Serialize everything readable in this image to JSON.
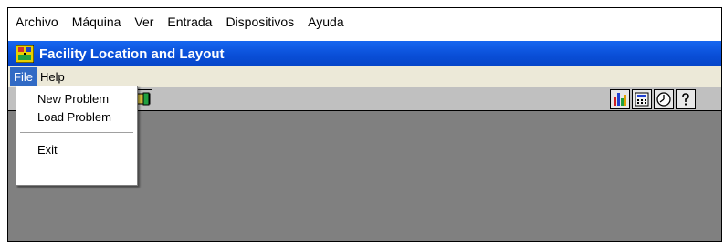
{
  "host_menu": [
    "Archivo",
    "Máquina",
    "Ver",
    "Entrada",
    "Dispositivos",
    "Ayuda"
  ],
  "window": {
    "title": "Facility Location and Layout"
  },
  "app_menu": {
    "file": "File",
    "help": "Help"
  },
  "file_menu": {
    "new_problem": "New Problem",
    "load_problem": "Load Problem",
    "exit": "Exit"
  },
  "toolbar": {
    "buttons": [
      {
        "icon": "bar-chart-icon"
      },
      {
        "icon": "calculator-icon"
      },
      {
        "icon": "clock-icon"
      },
      {
        "icon": "help-icon"
      }
    ]
  },
  "colors": {
    "titlebar": "#0a4fd8",
    "workspace": "#808080",
    "menu_highlight": "#316ac5"
  }
}
